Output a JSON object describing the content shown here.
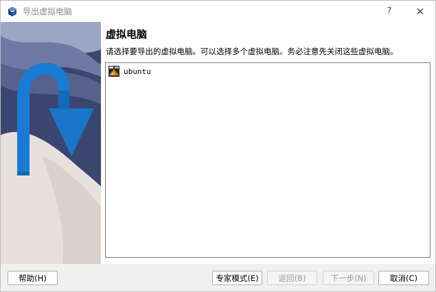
{
  "window": {
    "title": "导出虚拟电脑",
    "help_glyph": "?",
    "close_glyph": "✕"
  },
  "page": {
    "title": "虚拟电脑",
    "description": "请选择要导出的虚拟电脑。可以选择多个虚拟电脑。务必注意先关闭这些虚拟电脑。"
  },
  "vm_list": {
    "items": [
      {
        "name": "ubuntu",
        "icon": "ubuntu-os-icon"
      }
    ]
  },
  "buttons": {
    "help": "帮助(H)",
    "expert": "专家模式(E)",
    "back": "返回(B)",
    "next": "下一步(N)",
    "cancel": "取消(C)"
  },
  "colors": {
    "accent_blue": "#1a7bd6",
    "banner_dark": "#3b4670",
    "list_border": "#7a7a7a"
  }
}
